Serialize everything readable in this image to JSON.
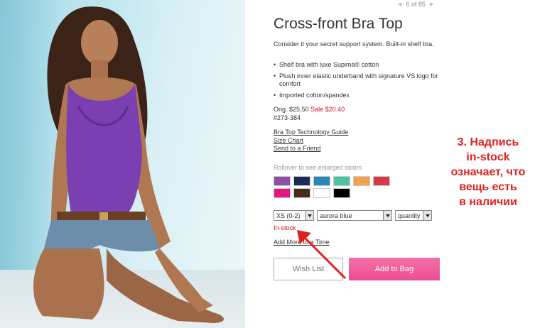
{
  "pager": {
    "text": "6 of 85",
    "prev_icon": "chevron-left-icon",
    "next_icon": "chevron-right-icon"
  },
  "product": {
    "title": "Cross-front Bra Top",
    "description": "Consider it your secret support system. Built-in shelf bra.",
    "bullets": [
      "Shelf bra with luxe Supima® cotton",
      "Plush inner elastic underband with signature VS logo for comfort",
      "Imported cotton/spandex"
    ],
    "price_orig_label": "Orig.",
    "price_orig": "$25.50",
    "price_sale": "Sale $20.40",
    "sku": "#273-384"
  },
  "links": {
    "guide": "Bra Top Technology Guide",
    "size_chart": "Size Chart",
    "send_friend": "Send to a Friend"
  },
  "colors": {
    "rollover_text": "Rollover to see enlarged colors",
    "swatches": [
      "#8f4fa6",
      "#1b2a55",
      "#2a87b9",
      "#4cc3a2",
      "#f2a04b",
      "#d93945",
      "#e5147f",
      "#4a2a1a",
      "#ffffff",
      "#000000"
    ]
  },
  "selects": {
    "size": "XS (0-2)",
    "color": "aurora blue",
    "quantity": "quantity"
  },
  "stock": {
    "status": "In-stock"
  },
  "add_more": "Add More to a Time",
  "buttons": {
    "wish_list": "Wish List",
    "add_to_bag": "Add to Bag"
  },
  "annotation": {
    "lines": [
      "3. Надпись",
      "in-stock",
      "означает, что",
      "вещь есть",
      "в наличии"
    ],
    "color": "#e02020"
  },
  "accent": {
    "sale": "#c8102e",
    "button_pink": "#ec4f8f"
  }
}
